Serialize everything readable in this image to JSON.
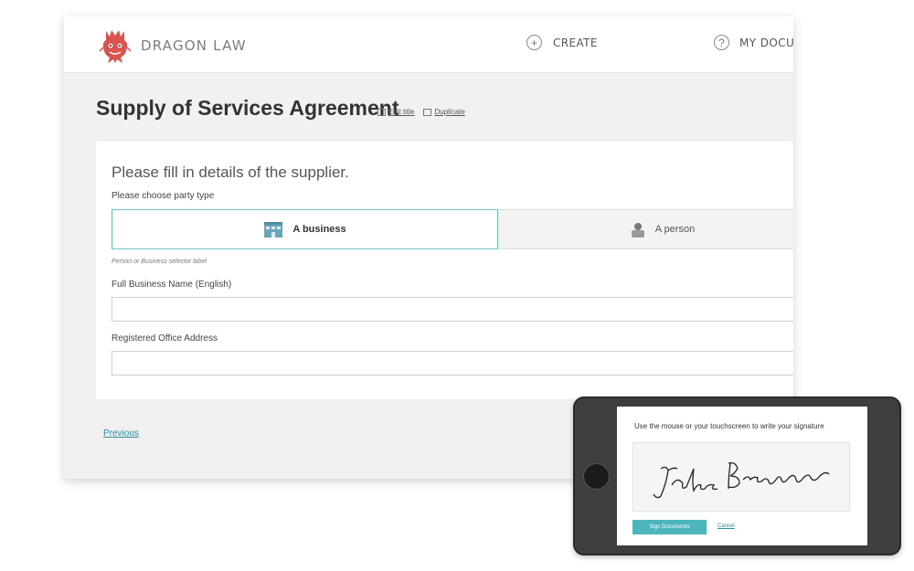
{
  "header": {
    "brand": "DRAGON LAW",
    "nav": {
      "create_label": "CREATE",
      "docs_label": "MY DOCUM",
      "create_icon": "plus-circle-icon",
      "docs_icon": "help-circle-icon"
    }
  },
  "document": {
    "title": "Supply of Services Agreement",
    "edit_title": "Edit title",
    "duplicate": "Duplicate"
  },
  "form": {
    "heading": "Please fill in details of the supplier.",
    "party_prompt": "Please choose party type",
    "party_options": [
      {
        "label": "A business",
        "icon": "building-icon",
        "selected": true
      },
      {
        "label": "A person",
        "icon": "person-icon",
        "selected": false
      }
    ],
    "party_help": "Person or Business selector label",
    "fields": [
      {
        "label": "Full Business Name (English)",
        "value": ""
      },
      {
        "label": "Registered Office Address",
        "value": ""
      }
    ],
    "previous": "Previous"
  },
  "signature": {
    "instruction": "Use the mouse or your touchscreen to write your signature",
    "sign_button": "Sign Documents",
    "cancel": "Cancel"
  },
  "colors": {
    "accent": "#4db6bd",
    "link": "#2f8da0",
    "logo_red": "#d9534f",
    "page_bg": "#f1f1f1"
  }
}
